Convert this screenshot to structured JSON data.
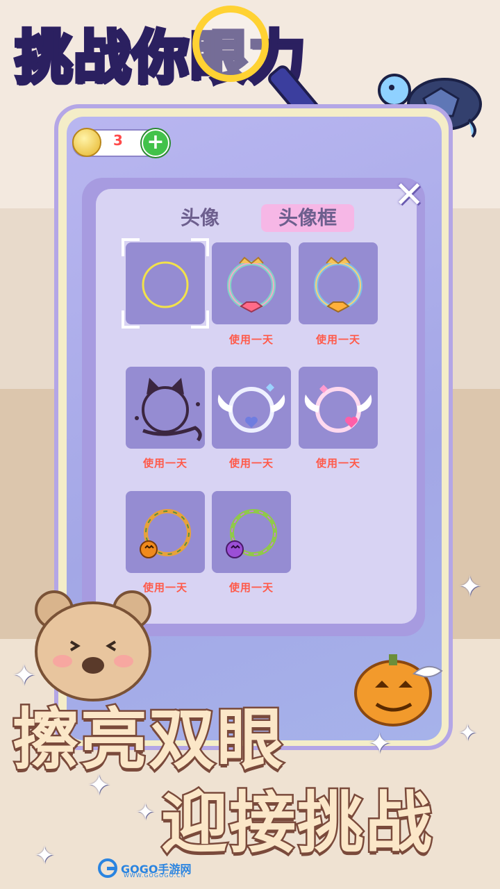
{
  "banner": {
    "title_part1": "挑战你",
    "title_highlight": "眼",
    "title_part2": "力"
  },
  "topbar": {
    "coin_count": "3",
    "add_button": "+"
  },
  "dialog": {
    "close": "✕",
    "tabs": [
      {
        "label": "头像",
        "active": false
      },
      {
        "label": "头像框",
        "active": true
      }
    ],
    "frames": [
      {
        "name": "default-frame",
        "label": "",
        "selected": true
      },
      {
        "name": "crown-frame-1",
        "label": "使用一天"
      },
      {
        "name": "crown-frame-2",
        "label": "使用一天"
      },
      {
        "name": "cat-frame",
        "label": "使用一天"
      },
      {
        "name": "angel-wing-frame-blue",
        "label": "使用一天"
      },
      {
        "name": "angel-wing-frame-pink",
        "label": "使用一天"
      },
      {
        "name": "halloween-frame-orange",
        "label": "使用一天"
      },
      {
        "name": "halloween-frame-purple",
        "label": "使用一天"
      }
    ]
  },
  "slogan": {
    "line1": "擦亮双眼",
    "line2": "迎接挑战"
  },
  "watermark": {
    "brand": "GOGO手游网",
    "url": "WWW.GOGOGO.CN"
  }
}
